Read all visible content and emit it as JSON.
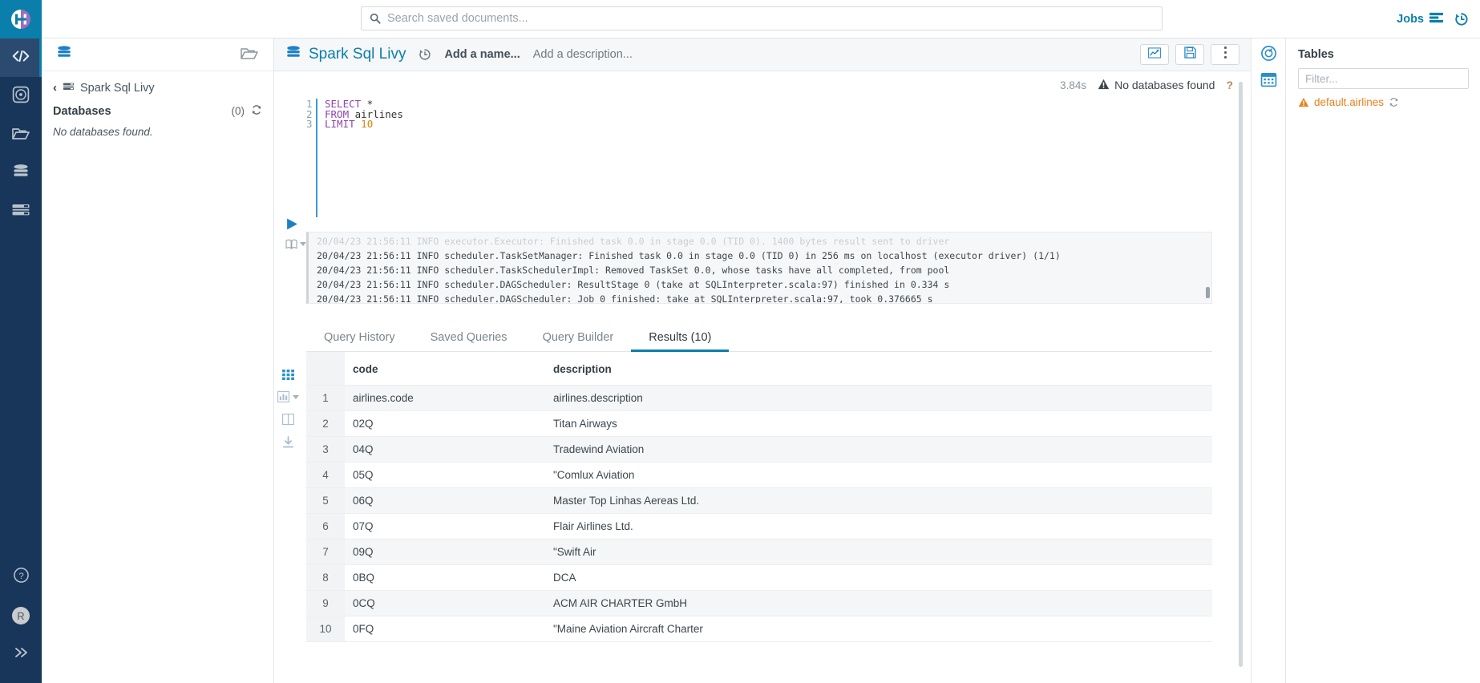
{
  "topbar": {
    "logo": "hue-logo",
    "search": {
      "placeholder": "Search saved documents...",
      "value": "",
      "icon": "search-icon"
    },
    "jobs_label": "Jobs",
    "jobs_icon": "jobs-list-icon",
    "history_icon": "history-icon"
  },
  "left_rail": {
    "items": [
      {
        "name": "editor",
        "icon": "code-icon",
        "active": true
      },
      {
        "name": "dashboard",
        "icon": "target-icon",
        "active": false
      },
      {
        "name": "browser",
        "icon": "folder-icon",
        "active": false
      },
      {
        "name": "databases",
        "icon": "database-icon",
        "active": false
      },
      {
        "name": "jobs",
        "icon": "server-icon",
        "active": false
      }
    ],
    "bottom": [
      {
        "name": "help",
        "icon": "question-circle-icon"
      },
      {
        "name": "user",
        "icon": "avatar",
        "label": "R"
      },
      {
        "name": "expand",
        "icon": "chevron-double-right-icon"
      }
    ]
  },
  "assist": {
    "header_icon_left": "database-icon",
    "header_icon_right": "folder-open-icon",
    "breadcrumb_back": "‹",
    "breadcrumb_icon": "server-icon",
    "breadcrumb_label": "Spark Sql Livy",
    "section_title": "Databases",
    "count": "(0)",
    "refresh_icon": "refresh-icon",
    "empty_text": "No databases found."
  },
  "doc_header": {
    "type_icon": "database-icon",
    "title": "Spark Sql Livy",
    "revision_icon": "history-icon",
    "name_placeholder": "Add a name...",
    "description_placeholder": "Add a description...",
    "buttons": [
      {
        "name": "chart-button",
        "icon": "chart-line-icon"
      },
      {
        "name": "save-button",
        "icon": "floppy-save-icon"
      },
      {
        "name": "more-button",
        "icon": "vertical-dots-icon"
      }
    ]
  },
  "status": {
    "elapsed": "3.84s",
    "warning_icon": "warning-triangle-icon",
    "warning_text": "No databases found",
    "help_label": "?"
  },
  "editor": {
    "run_icon": "play-icon",
    "book_icon": "book-icon",
    "caret_icon": "chevron-down-icon",
    "lines": [
      {
        "n": "1",
        "tokens": [
          {
            "t": "SELECT",
            "c": "kw"
          },
          {
            "t": " *",
            "c": "pl"
          }
        ]
      },
      {
        "n": "2",
        "tokens": [
          {
            "t": "FROM",
            "c": "kw"
          },
          {
            "t": " airlines",
            "c": "pl"
          }
        ]
      },
      {
        "n": "3",
        "tokens": [
          {
            "t": "LIMIT",
            "c": "kw"
          },
          {
            "t": " ",
            "c": "pl"
          },
          {
            "t": "10",
            "c": "num"
          }
        ]
      }
    ]
  },
  "logs": {
    "lines": [
      {
        "text": "20/04/23 21:56:11 INFO executor.Executor: Finished task 0.0 in stage 0.0 (TID 0). 1400 bytes result sent to driver",
        "faded": true
      },
      {
        "text": "20/04/23 21:56:11 INFO scheduler.TaskSetManager: Finished task 0.0 in stage 0.0 (TID 0) in 256 ms on localhost (executor driver) (1/1)",
        "faded": false
      },
      {
        "text": "20/04/23 21:56:11 INFO scheduler.TaskSchedulerImpl: Removed TaskSet 0.0, whose tasks have all completed, from pool",
        "faded": false
      },
      {
        "text": "20/04/23 21:56:11 INFO scheduler.DAGScheduler: ResultStage 0 (take at SQLInterpreter.scala:97) finished in 0.334 s",
        "faded": false
      },
      {
        "text": "20/04/23 21:56:11 INFO scheduler.DAGScheduler: Job 0 finished: take at SQLInterpreter.scala:97, took 0.376665 s",
        "faded": false
      }
    ],
    "grip": "···"
  },
  "tabs": [
    {
      "label": "Query History",
      "active": false
    },
    {
      "label": "Saved Queries",
      "active": false
    },
    {
      "label": "Query Builder",
      "active": false
    },
    {
      "label": "Results (10)",
      "active": true
    }
  ],
  "result_tools": [
    {
      "name": "grid-view-icon",
      "on": true
    },
    {
      "name": "chart-bar-icon",
      "on": false,
      "caret": true
    },
    {
      "name": "columns-icon",
      "on": false
    },
    {
      "name": "download-icon",
      "on": false
    }
  ],
  "results": {
    "columns": [
      "",
      "code",
      "description"
    ],
    "rows": [
      {
        "idx": "1",
        "code": "airlines.code",
        "description": "airlines.description"
      },
      {
        "idx": "2",
        "code": "02Q",
        "description": "Titan Airways"
      },
      {
        "idx": "3",
        "code": "04Q",
        "description": "Tradewind Aviation"
      },
      {
        "idx": "4",
        "code": "05Q",
        "description": "\"Comlux Aviation"
      },
      {
        "idx": "5",
        "code": "06Q",
        "description": "Master Top Linhas Aereas Ltd."
      },
      {
        "idx": "6",
        "code": "07Q",
        "description": "Flair Airlines Ltd."
      },
      {
        "idx": "7",
        "code": "09Q",
        "description": "\"Swift Air"
      },
      {
        "idx": "8",
        "code": "0BQ",
        "description": "DCA"
      },
      {
        "idx": "9",
        "code": "0CQ",
        "description": "ACM AIR CHARTER GmbH"
      },
      {
        "idx": "10",
        "code": "0FQ",
        "description": "\"Maine Aviation Aircraft Charter"
      }
    ]
  },
  "right_rail": [
    {
      "name": "assistant-icon"
    },
    {
      "name": "calendar-icon"
    }
  ],
  "tables_panel": {
    "title": "Tables",
    "filter_placeholder": "Filter...",
    "filter_value": "",
    "items": [
      {
        "label": "default.airlines",
        "warning_icon": "warning-triangle-icon",
        "refresh_icon": "refresh-icon"
      }
    ]
  },
  "colors": {
    "accent": "#0B7FAB",
    "rail_bg": "#17365a",
    "logo_bg": "#0B7FAB",
    "warn_orange": "#e8821e",
    "keyword_purple": "#8e44ad",
    "number_orange": "#d2860a"
  }
}
